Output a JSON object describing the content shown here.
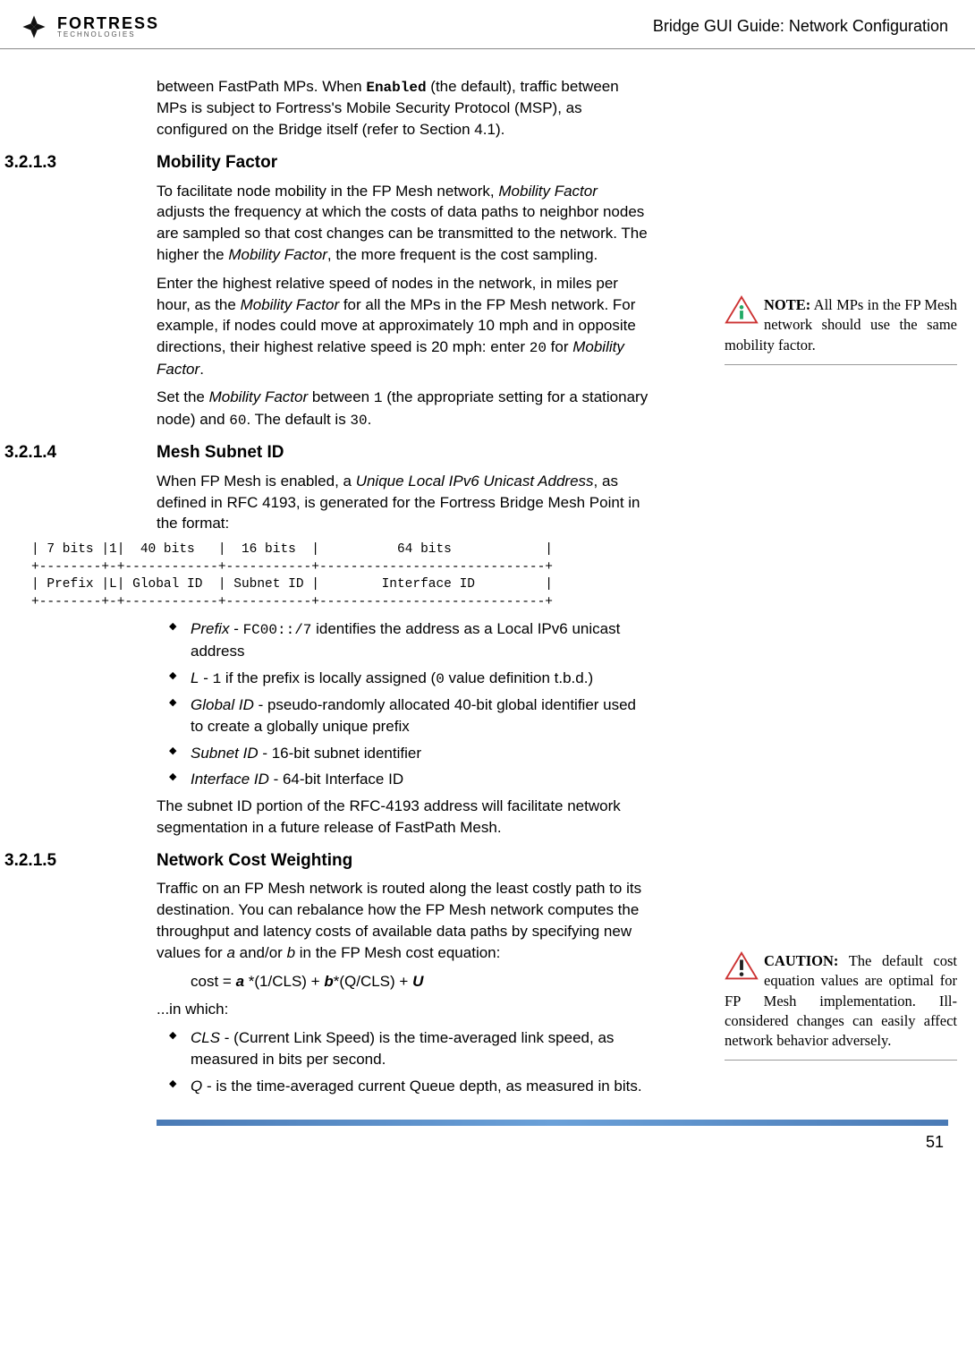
{
  "header": {
    "brand": "FORTRESS",
    "brand_sub": "TECHNOLOGIES",
    "doc_title": "Bridge GUI Guide: Network Configuration"
  },
  "intro": {
    "p1_a": "between FastPath MPs. When ",
    "p1_b": "Enabled",
    "p1_c": " (the default), traffic between MPs is subject to Fortress's Mobile Security Protocol (MSP), as configured on the Bridge itself (refer to Section 4.1)."
  },
  "s3213": {
    "num": "3.2.1.3",
    "title": "Mobility Factor",
    "p1_a": "To facilitate node mobility in the FP Mesh network, ",
    "p1_b": "Mobility Factor",
    "p1_c": " adjusts the frequency at which the costs of data paths to neighbor nodes are sampled so that cost changes can be transmitted to the network. The higher the ",
    "p1_d": "Mobility Factor",
    "p1_e": ", the more frequent is the cost sampling.",
    "p2_a": "Enter the highest relative speed of nodes in the network, in miles per hour, as the ",
    "p2_b": "Mobility Factor",
    "p2_c": " for all the MPs in the FP Mesh network. For example, if nodes could move at approximately 10 mph and in opposite directions, their highest relative speed is 20 mph: enter ",
    "p2_d": "20",
    "p2_e": " for ",
    "p2_f": "Mobility Factor",
    "p2_g": ".",
    "p3_a": "Set the ",
    "p3_b": "Mobility Factor",
    "p3_c": " between ",
    "p3_d": "1",
    "p3_e": " (the appropriate setting for a stationary node) and ",
    "p3_f": "60",
    "p3_g": ". The default is ",
    "p3_h": "30",
    "p3_i": "."
  },
  "note1": {
    "label": "NOTE:",
    "text": " All MPs in the FP Mesh net­work should use the same mobility factor."
  },
  "s3214": {
    "num": "3.2.1.4",
    "title": "Mesh Subnet ID",
    "p1_a": "When FP Mesh is enabled, a ",
    "p1_b": "Unique Local IPv6 Unicast Address",
    "p1_c": ", as defined in RFC 4193, is generated for the Fortress Bridge Mesh Point in the format:",
    "diagram": "| 7 bits |1|  40 bits   |  16 bits  |          64 bits            |\n+--------+-+------------+-----------+-----------------------------+\n| Prefix |L| Global ID  | Subnet ID |        Interface ID         |\n+--------+-+------------+-----------+-----------------------------+",
    "b1_a": "Prefix",
    "b1_b": " - ",
    "b1_c": "FC00::/7",
    "b1_d": " identifies the address as a Local IPv6 unicast address",
    "b2_a": "L",
    "b2_b": " - ",
    "b2_c": "1",
    "b2_d": " if the prefix is locally assigned (",
    "b2_e": "0",
    "b2_f": " value definition t.b.d.)",
    "b3_a": "Global ID",
    "b3_b": " - pseudo-randomly allocated 40-bit global identifier used to create a globally unique prefix",
    "b4_a": "Subnet ID",
    "b4_b": " - 16-bit subnet identifier",
    "b5_a": "Interface ID",
    "b5_b": " - 64-bit Interface ID",
    "p2": "The subnet ID portion of the RFC-4193 address will facilitate network segmentation in a future release of FastPath Mesh."
  },
  "s3215": {
    "num": "3.2.1.5",
    "title": "Network Cost Weighting",
    "p1_a": "Traffic on an FP Mesh network is routed along the least costly path to its destination. You can rebalance how the FP Mesh network computes the throughput and latency costs of available data paths by specifying new values for ",
    "p1_b": "a",
    "p1_c": " and/or ",
    "p1_d": "b",
    "p1_e": " in the FP Mesh cost equation:",
    "eq_a": "cost = ",
    "eq_b": "a",
    "eq_c": " *(1/CLS) + ",
    "eq_d": "b",
    "eq_e": "*(Q/CLS) + ",
    "eq_f": "U",
    "p2": "...in which:",
    "b1_a": "CLS",
    "b1_b": " - (Current Link Speed) is the time-averaged link speed, as measured in bits per second.",
    "b2_a": "Q",
    "b2_b": " - is the time-averaged current Queue depth, as measured in bits."
  },
  "note2": {
    "label": "CAUTION:",
    "text": " The de­fault cost equa­tion values are optimal for FP Mesh implemen­tation. Ill-considered changes can easily affect network behavior ad­versely."
  },
  "page_num": "51"
}
